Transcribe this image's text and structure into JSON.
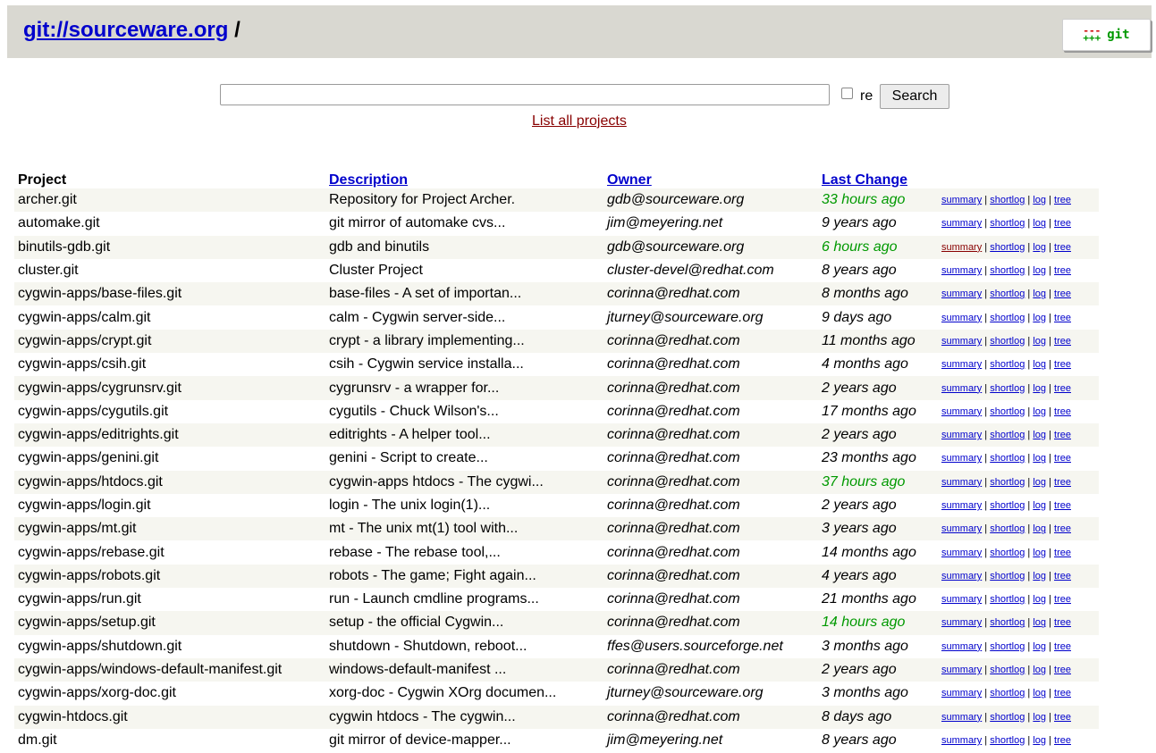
{
  "header": {
    "site_link": "git://sourceware.org",
    "site_suffix": "/",
    "logo_mark_top": "---",
    "logo_mark_bottom": "+++",
    "logo_text": "git"
  },
  "search": {
    "value": "",
    "re_label": "re",
    "button_label": "Search",
    "list_all_label": "List all projects"
  },
  "table": {
    "columns": [
      "Project",
      "Description",
      "Owner",
      "Last Change"
    ],
    "links": [
      "summary",
      "shortlog",
      "log",
      "tree"
    ],
    "separator": "|",
    "rows": [
      {
        "project": "archer.git",
        "description": "Repository for Project Archer.",
        "owner": "gdb@sourceware.org",
        "age": "33 hours ago",
        "recent": true
      },
      {
        "project": "automake.git",
        "description": "git mirror of automake cvs...",
        "owner": "jim@meyering.net",
        "age": "9 years ago",
        "recent": false
      },
      {
        "project": "binutils-gdb.git",
        "description": "gdb and binutils",
        "owner": "gdb@sourceware.org",
        "age": "6 hours ago",
        "recent": true
      },
      {
        "project": "cluster.git",
        "description": "Cluster Project",
        "owner": "cluster-devel@redhat.com",
        "age": "8 years ago",
        "recent": false
      },
      {
        "project": "cygwin-apps/base-files.git",
        "description": "base-files - A set of importan...",
        "owner": "corinna@redhat.com",
        "age": "8 months ago",
        "recent": false
      },
      {
        "project": "cygwin-apps/calm.git",
        "description": "calm - Cygwin server-side...",
        "owner": "jturney@sourceware.org",
        "age": "9 days ago",
        "recent": false
      },
      {
        "project": "cygwin-apps/crypt.git",
        "description": "crypt - a library implementing...",
        "owner": "corinna@redhat.com",
        "age": "11 months ago",
        "recent": false
      },
      {
        "project": "cygwin-apps/csih.git",
        "description": "csih - Cygwin service installa...",
        "owner": "corinna@redhat.com",
        "age": "4 months ago",
        "recent": false
      },
      {
        "project": "cygwin-apps/cygrunsrv.git",
        "description": "cygrunsrv - a wrapper for...",
        "owner": "corinna@redhat.com",
        "age": "2 years ago",
        "recent": false
      },
      {
        "project": "cygwin-apps/cygutils.git",
        "description": "cygutils - Chuck Wilson's...",
        "owner": "corinna@redhat.com",
        "age": "17 months ago",
        "recent": false
      },
      {
        "project": "cygwin-apps/editrights.git",
        "description": "editrights - A helper tool...",
        "owner": "corinna@redhat.com",
        "age": "2 years ago",
        "recent": false
      },
      {
        "project": "cygwin-apps/genini.git",
        "description": "genini - Script to create...",
        "owner": "corinna@redhat.com",
        "age": "23 months ago",
        "recent": false
      },
      {
        "project": "cygwin-apps/htdocs.git",
        "description": "cygwin-apps htdocs - The cygwi...",
        "owner": "corinna@redhat.com",
        "age": "37 hours ago",
        "recent": true
      },
      {
        "project": "cygwin-apps/login.git",
        "description": "login - The unix login(1)...",
        "owner": "corinna@redhat.com",
        "age": "2 years ago",
        "recent": false
      },
      {
        "project": "cygwin-apps/mt.git",
        "description": "mt - The unix mt(1) tool with...",
        "owner": "corinna@redhat.com",
        "age": "3 years ago",
        "recent": false
      },
      {
        "project": "cygwin-apps/rebase.git",
        "description": "rebase - The rebase tool,...",
        "owner": "corinna@redhat.com",
        "age": "14 months ago",
        "recent": false
      },
      {
        "project": "cygwin-apps/robots.git",
        "description": "robots - The game; Fight again...",
        "owner": "corinna@redhat.com",
        "age": "4 years ago",
        "recent": false
      },
      {
        "project": "cygwin-apps/run.git",
        "description": "run - Launch cmdline programs...",
        "owner": "corinna@redhat.com",
        "age": "21 months ago",
        "recent": false
      },
      {
        "project": "cygwin-apps/setup.git",
        "description": "setup - the official Cygwin...",
        "owner": "corinna@redhat.com",
        "age": "14 hours ago",
        "recent": true
      },
      {
        "project": "cygwin-apps/shutdown.git",
        "description": "shutdown - Shutdown, reboot...",
        "owner": "ffes@users.sourceforge.net",
        "age": "3 months ago",
        "recent": false
      },
      {
        "project": "cygwin-apps/windows-default-manifest.git",
        "description": "windows-default-manifest ...",
        "owner": "corinna@redhat.com",
        "age": "2 years ago",
        "recent": false
      },
      {
        "project": "cygwin-apps/xorg-doc.git",
        "description": "xorg-doc - Cygwin XOrg documen...",
        "owner": "jturney@sourceware.org",
        "age": "3 months ago",
        "recent": false
      },
      {
        "project": "cygwin-htdocs.git",
        "description": "cygwin htdocs - The cygwin...",
        "owner": "corinna@redhat.com",
        "age": "8 days ago",
        "recent": false
      },
      {
        "project": "dm.git",
        "description": "git mirror of device-mapper...",
        "owner": "jim@meyering.net",
        "age": "8 years ago",
        "recent": false
      }
    ]
  },
  "colors": {
    "header_bg": "#d9d8d1",
    "link": "#0000cc",
    "visited_link": "#880000",
    "recent_age": "#009900",
    "row_alt_bg": "#f6f6f0"
  }
}
